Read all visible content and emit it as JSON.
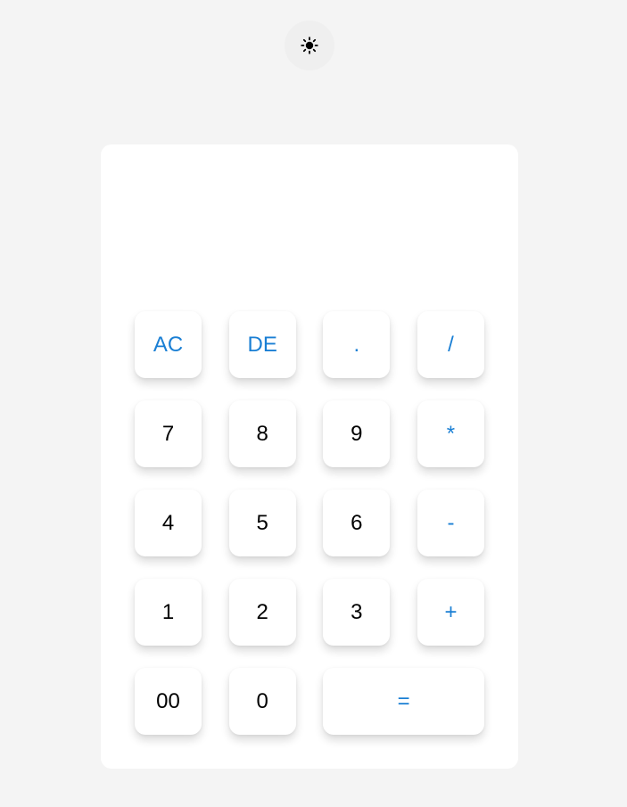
{
  "theme_toggle": {
    "icon": "sun-icon"
  },
  "display": {
    "value": ""
  },
  "colors": {
    "background": "#f4f4f4",
    "panel": "#ffffff",
    "accent": "#1a7fd4",
    "digit": "#000000"
  },
  "keys": [
    {
      "label": "AC",
      "kind": "operator"
    },
    {
      "label": "DE",
      "kind": "operator"
    },
    {
      "label": ".",
      "kind": "operator"
    },
    {
      "label": "/",
      "kind": "operator"
    },
    {
      "label": "7",
      "kind": "digit"
    },
    {
      "label": "8",
      "kind": "digit"
    },
    {
      "label": "9",
      "kind": "digit"
    },
    {
      "label": "*",
      "kind": "operator"
    },
    {
      "label": "4",
      "kind": "digit"
    },
    {
      "label": "5",
      "kind": "digit"
    },
    {
      "label": "6",
      "kind": "digit"
    },
    {
      "label": "-",
      "kind": "operator"
    },
    {
      "label": "1",
      "kind": "digit"
    },
    {
      "label": "2",
      "kind": "digit"
    },
    {
      "label": "3",
      "kind": "digit"
    },
    {
      "label": "+",
      "kind": "operator"
    },
    {
      "label": "00",
      "kind": "digit"
    },
    {
      "label": "0",
      "kind": "digit"
    },
    {
      "label": "=",
      "kind": "operator"
    }
  ]
}
